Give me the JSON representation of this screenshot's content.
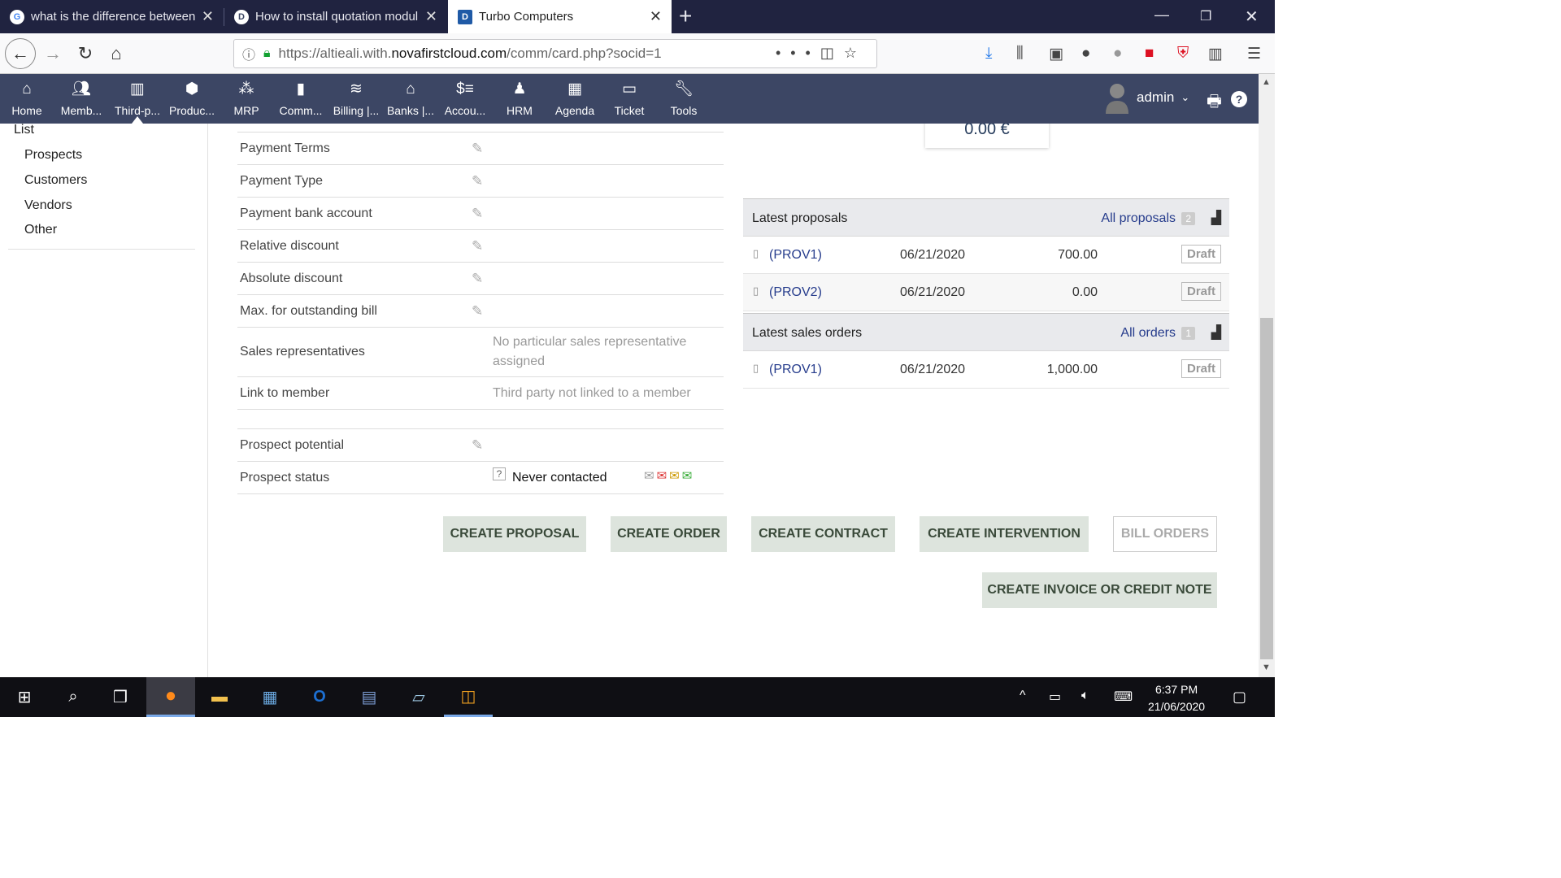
{
  "browser": {
    "tabs": [
      {
        "title": "what is the difference between",
        "favicon": "G"
      },
      {
        "title": "How to install quotation modul",
        "favicon": "speech-bubble-icon"
      },
      {
        "title": "Turbo Computers",
        "favicon": "D"
      }
    ],
    "url_prefix": "https://altieali.with.",
    "url_domain": "novafirstcloud.com",
    "url_path": "/comm/card.php?socid=1"
  },
  "topmenu": {
    "items": [
      {
        "label": "Home",
        "icon": "home-icon"
      },
      {
        "label": "Memb...",
        "icon": "members-icon"
      },
      {
        "label": "Third-p...",
        "icon": "building-icon"
      },
      {
        "label": "Produc...",
        "icon": "box-icon"
      },
      {
        "label": "MRP",
        "icon": "cubes-icon"
      },
      {
        "label": "Comm...",
        "icon": "briefcase-icon"
      },
      {
        "label": "Billing |...",
        "icon": "coins-icon"
      },
      {
        "label": "Banks |...",
        "icon": "bank-icon"
      },
      {
        "label": "Accou...",
        "icon": "accounting-icon"
      },
      {
        "label": "HRM",
        "icon": "user-tie-icon"
      },
      {
        "label": "Agenda",
        "icon": "calendar-icon"
      },
      {
        "label": "Ticket",
        "icon": "ticket-icon"
      },
      {
        "label": "Tools",
        "icon": "wrench-icon"
      }
    ],
    "user": "admin"
  },
  "leftmenu": {
    "list_label": "List",
    "items": [
      "Prospects",
      "Customers",
      "Vendors",
      "Other"
    ]
  },
  "fields": [
    {
      "label": "Payment Terms",
      "value": ""
    },
    {
      "label": "Payment Type",
      "value": ""
    },
    {
      "label": "Payment bank account",
      "value": ""
    },
    {
      "label": "Relative discount",
      "value": ""
    },
    {
      "label": "Absolute discount",
      "value": ""
    },
    {
      "label": "Max. for outstanding bill",
      "value": ""
    },
    {
      "label": "Sales representatives",
      "value": "No particular sales representative assigned"
    },
    {
      "label": "Link to member",
      "value": "Third party not linked to a member"
    },
    {
      "label": "Prospect potential",
      "value": ""
    },
    {
      "label": "Prospect status",
      "value": "Never contacted"
    }
  ],
  "amount": "0.00 €",
  "proposals": {
    "title": "Latest proposals",
    "all_label": "All proposals",
    "count": "2",
    "rows": [
      {
        "ref": "(PROV1)",
        "date": "06/21/2020",
        "amount": "700.00",
        "status": "Draft"
      },
      {
        "ref": "(PROV2)",
        "date": "06/21/2020",
        "amount": "0.00",
        "status": "Draft"
      }
    ]
  },
  "orders": {
    "title": "Latest sales orders",
    "all_label": "All orders",
    "count": "1",
    "rows": [
      {
        "ref": "(PROV1)",
        "date": "06/21/2020",
        "amount": "1,000.00",
        "status": "Draft"
      }
    ]
  },
  "actions": {
    "create_proposal": "CREATE PROPOSAL",
    "create_order": "CREATE ORDER",
    "create_contract": "CREATE CONTRACT",
    "create_intervention": "CREATE INTERVENTION",
    "bill_orders": "BILL ORDERS",
    "create_invoice": "CREATE INVOICE OR CREDIT NOTE"
  },
  "taskbar": {
    "time": "6:37 PM",
    "date": "21/06/2020"
  },
  "colors": {
    "menu_bg": "#3c4664",
    "tabstrip_bg": "#202340",
    "button_bg": "#dde4dd",
    "link": "#263c8c"
  }
}
